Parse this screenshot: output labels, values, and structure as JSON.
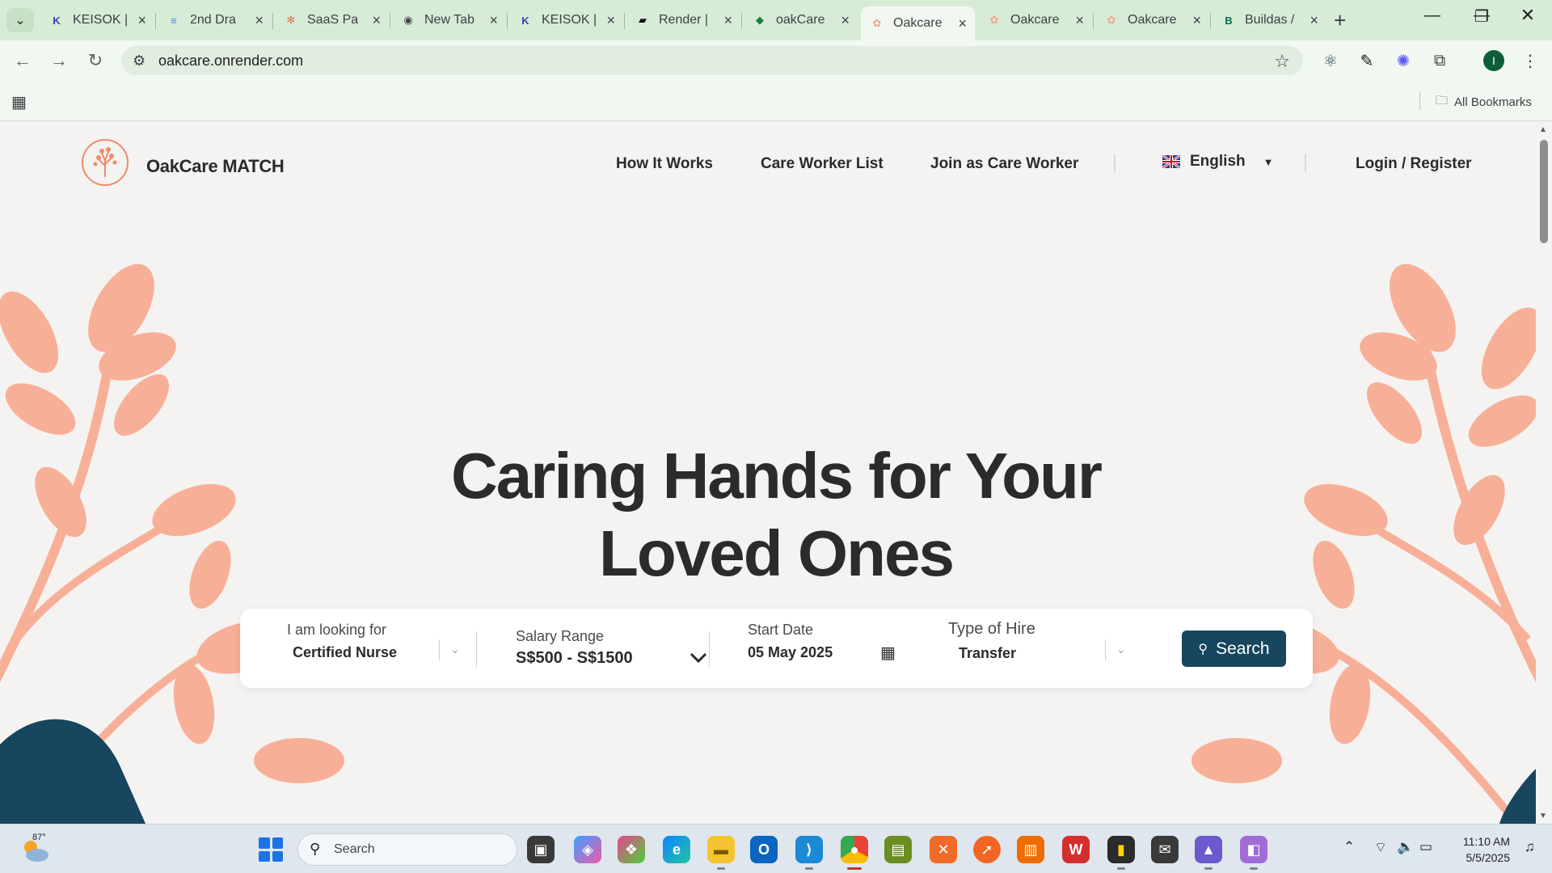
{
  "browser": {
    "tabs": [
      {
        "title": "KEISOK |",
        "favicon": "keisok-icon",
        "color": "#3b3bb8",
        "glyph": "K"
      },
      {
        "title": "2nd Dra",
        "favicon": "docs-icon",
        "color": "#4285f4",
        "glyph": "≡"
      },
      {
        "title": "SaaS Pa",
        "favicon": "claude-icon",
        "color": "#d9774f",
        "glyph": "✻"
      },
      {
        "title": "New Tab",
        "favicon": "chrome-icon",
        "color": "#444",
        "glyph": "◉"
      },
      {
        "title": "KEISOK |",
        "favicon": "keisok-icon",
        "color": "#3b3bb8",
        "glyph": "K"
      },
      {
        "title": "Render |",
        "favicon": "render-icon",
        "color": "#111",
        "glyph": "▰"
      },
      {
        "title": "oakCare",
        "favicon": "github-icon",
        "color": "#1a7f37",
        "glyph": "◆"
      },
      {
        "title": "Oakcare",
        "favicon": "oakcare-icon",
        "color": "#f0a58b",
        "glyph": "✿",
        "active": true
      },
      {
        "title": "Oakcare",
        "favicon": "oakcare-icon",
        "color": "#f0a58b",
        "glyph": "✿"
      },
      {
        "title": "Oakcare",
        "favicon": "oakcare-icon",
        "color": "#f0a58b",
        "glyph": "✿"
      },
      {
        "title": "Buildas /",
        "favicon": "buildas-icon",
        "color": "#0b6e4f",
        "glyph": "B"
      }
    ],
    "url": "oakcare.onrender.com",
    "bookmarks_label": "All Bookmarks",
    "profile_initial": "I"
  },
  "site": {
    "brand": "OakCare MATCH",
    "nav": {
      "how_it_works": "How It Works",
      "care_worker_list": "Care Worker List",
      "join": "Join as Care Worker",
      "language": "English",
      "login": "Login / Register"
    },
    "hero_line1": "Caring Hands for Your",
    "hero_line2": "Loved Ones",
    "search": {
      "looking_label": "I am looking for",
      "looking_value": "Certified Nurse",
      "salary_label": "Salary Range",
      "salary_value": "S$500 - S$1500",
      "date_label": "Start Date",
      "date_value": "05 May 2025",
      "hire_label": "Type of Hire",
      "hire_value": "Transfer",
      "button": "Search"
    },
    "colors": {
      "accent": "#f7b097",
      "primary": "#17465e",
      "background": "#f5f3f1"
    }
  },
  "taskbar": {
    "temperature": "87°",
    "search_placeholder": "Search",
    "time": "11:10 AM",
    "date": "5/5/2025"
  }
}
